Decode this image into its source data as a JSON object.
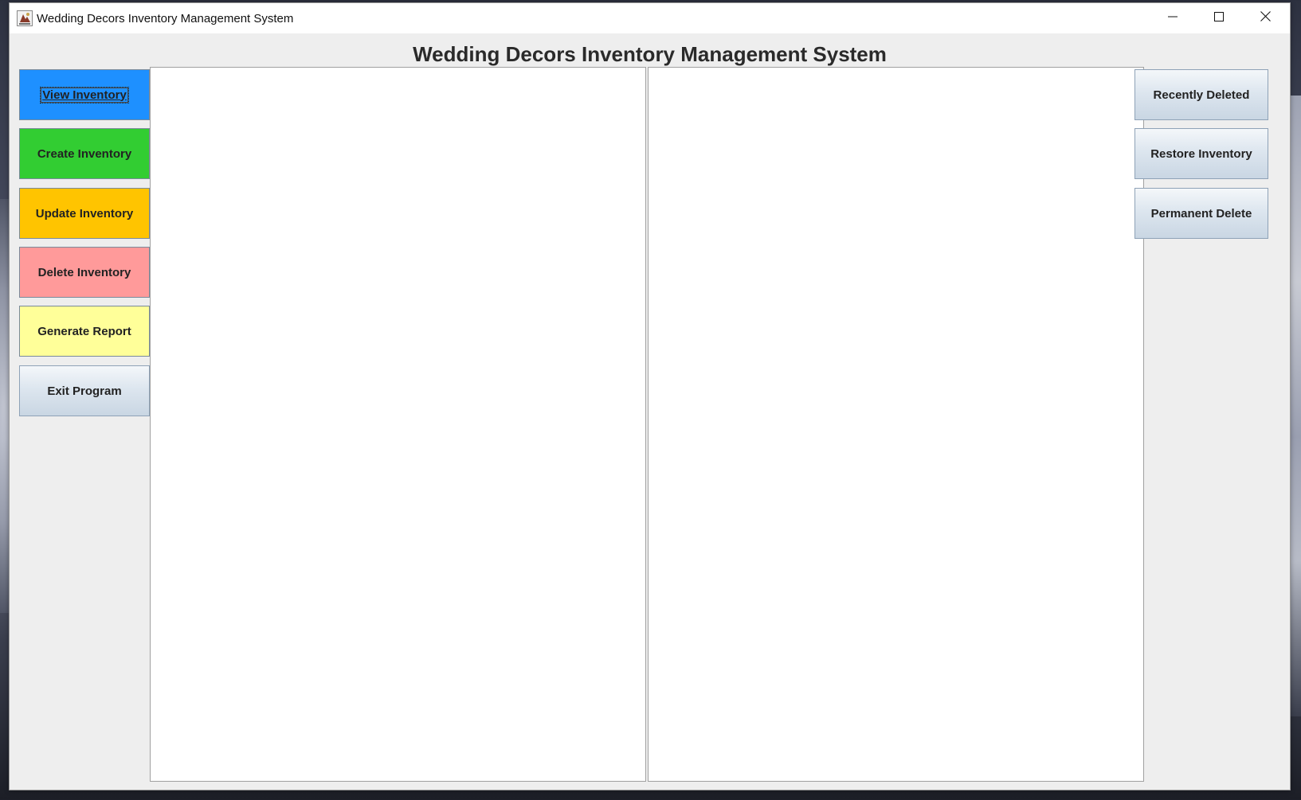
{
  "window": {
    "title": "Wedding Decors Inventory Management System",
    "controls": {
      "minimize": "minimize-icon",
      "maximize": "maximize-icon",
      "close": "close-icon"
    }
  },
  "header": {
    "title": "Wedding Decors Inventory Management System"
  },
  "left_buttons": [
    {
      "label": "View Inventory",
      "color": "#1e90ff",
      "focused": true
    },
    {
      "label": "Create Inventory",
      "color": "#32cd32"
    },
    {
      "label": "Update Inventory",
      "color": "#ffc400"
    },
    {
      "label": "Delete Inventory",
      "color": "#ff9a9a"
    },
    {
      "label": "Generate Report",
      "color": "#ffff99"
    },
    {
      "label": "Exit Program",
      "color": "#dde6ef"
    }
  ],
  "right_buttons": [
    {
      "label": "Recently Deleted"
    },
    {
      "label": "Restore Inventory"
    },
    {
      "label": "Permanent Delete"
    }
  ]
}
